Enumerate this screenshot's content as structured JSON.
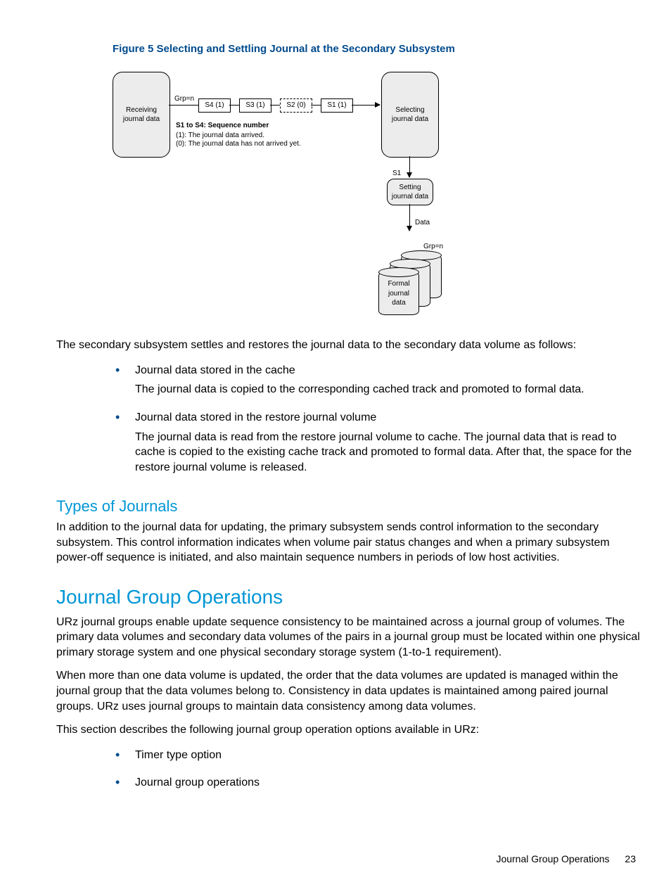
{
  "figure": {
    "caption": "Figure 5 Selecting and Settling Journal at the Secondary Subsystem",
    "box_receiving": "Receiving\njournal data",
    "box_selecting": "Selecting\njournal data",
    "box_setting": "Setting\njournal data",
    "grp_label": "Grp=n",
    "seq": [
      "S4 (1)",
      "S3 (1)",
      "S2 (0)",
      "S1 (1)"
    ],
    "legend_title": "S1 to S4: Sequence number",
    "legend_1": "(1): The journal data arrived.",
    "legend_0": "(0): The journal data has not arrived yet.",
    "s1_label": "S1",
    "data_label": "Data",
    "grp_label2": "Grp=n",
    "cyl_label": "Formal\njournal\ndata"
  },
  "para_intro": "The secondary subsystem settles and restores the journal data to the secondary data volume as follows:",
  "bullets1": [
    {
      "title": "Journal data stored in the cache",
      "sub": "The journal data is copied to the corresponding cached track and promoted to formal data."
    },
    {
      "title": "Journal data stored in the restore journal volume",
      "sub": "The journal data is read from the restore journal volume to cache. The journal data that is read to cache is copied to the existing cache track and promoted to formal data. After that, the space for the restore journal volume is released."
    }
  ],
  "h_types": "Types of Journals",
  "para_types": "In addition to the journal data for updating, the primary subsystem sends control information to the secondary subsystem. This control information indicates when volume pair status changes and when a primary subsystem power-off sequence is initiated, and also maintain sequence numbers in periods of low host activities.",
  "h_ops": "Journal Group Operations",
  "para_ops1": "URz journal groups enable update sequence consistency to be maintained across a journal group of volumes. The primary data volumes and secondary data volumes of the pairs in a journal group must be located within one physical primary storage system and one physical secondary storage system (1-to-1 requirement).",
  "para_ops2": "When more than one data volume is updated, the order that the data volumes are updated is managed within the journal group that the data volumes belong to. Consistency in data updates is maintained among paired journal groups. URz uses journal groups to maintain data consistency among data volumes.",
  "para_ops3": "This section describes the following journal group operation options available in URz:",
  "bullets2": [
    {
      "title": "Timer type option"
    },
    {
      "title": "Journal group operations"
    }
  ],
  "footer": {
    "text": "Journal Group Operations",
    "page": "23"
  }
}
